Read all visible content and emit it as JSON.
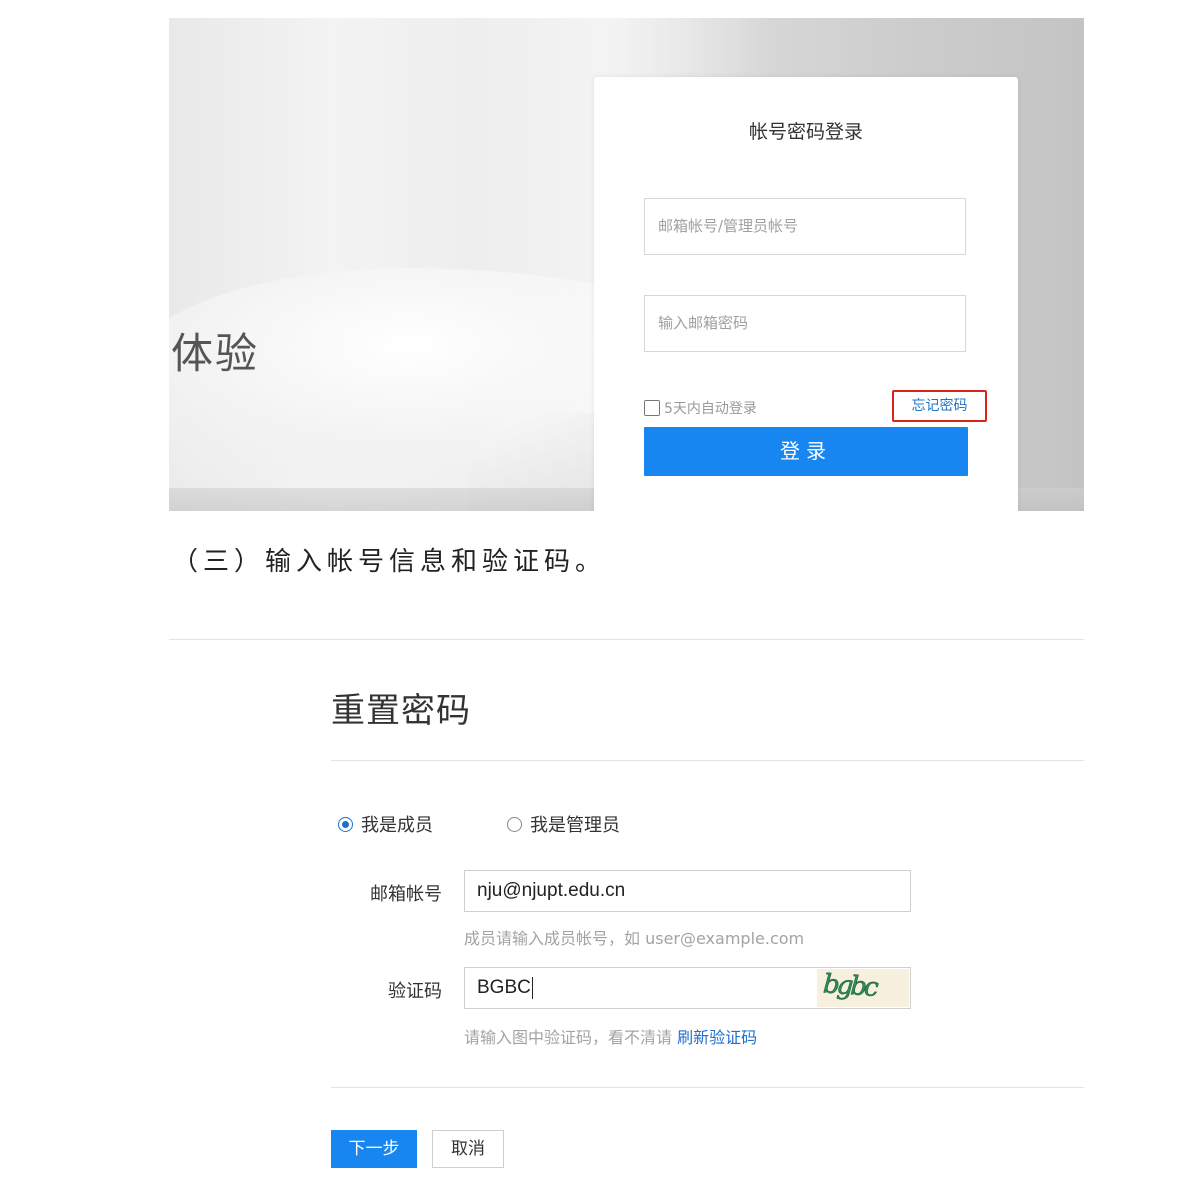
{
  "login_screenshot": {
    "hero_text": "体验",
    "card_title": "帐号密码登录",
    "username_placeholder": "邮箱帐号/管理员帐号",
    "password_placeholder": "输入邮箱密码",
    "remember_label": "5天内自动登录",
    "forgot_label": "忘记密码",
    "login_label": "登录",
    "highlight_color": "#d9261c",
    "button_color": "#1786f0"
  },
  "caption": "（三）输入帐号信息和验证码。",
  "reset_screenshot": {
    "title": "重置密码",
    "roles": {
      "member_label": "我是成员",
      "admin_label": "我是管理员",
      "selected": "member"
    },
    "email_label": "邮箱帐号",
    "email_value": "nju@njupt.edu.cn",
    "email_hint": "成员请输入成员帐号，如 user@example.com",
    "captcha_label": "验证码",
    "captcha_value": "BGBC",
    "captcha_image_text": "bgbc",
    "captcha_hint_prefix": "请输入图中验证码，看不清请",
    "captcha_refresh_link": "刷新验证码",
    "next_label": "下一步",
    "cancel_label": "取消"
  }
}
